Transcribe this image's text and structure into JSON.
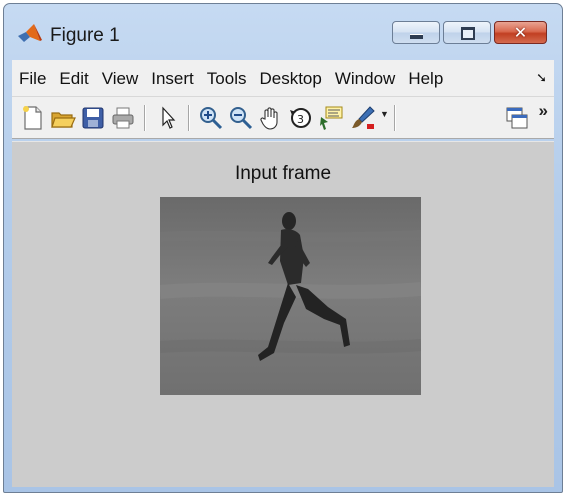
{
  "window": {
    "title": "Figure 1",
    "icon": "matlab-icon",
    "buttons": {
      "minimize": "minimize-icon",
      "maximize": "maximize-icon",
      "close": "close-icon"
    }
  },
  "menubar": {
    "items": [
      "File",
      "Edit",
      "View",
      "Insert",
      "Tools",
      "Desktop",
      "Window",
      "Help"
    ],
    "overflow_icon": "chevron-more-icon"
  },
  "toolbar": {
    "icons": [
      "new-figure-icon",
      "open-file-icon",
      "save-icon",
      "print-icon",
      "arrow-pointer-icon",
      "zoom-in-icon",
      "zoom-out-icon",
      "pan-hand-icon",
      "rotate-3d-icon",
      "data-cursor-icon",
      "brush-icon",
      "dropdown-arrow-icon",
      "link-plot-icon",
      "more-chevron-icon"
    ],
    "more_label": "»"
  },
  "axes": {
    "title": "Input frame"
  },
  "colors": {
    "title_bar": "#b4cdeb",
    "figure_background": "#cccccc",
    "close_button": "#c13f22"
  }
}
